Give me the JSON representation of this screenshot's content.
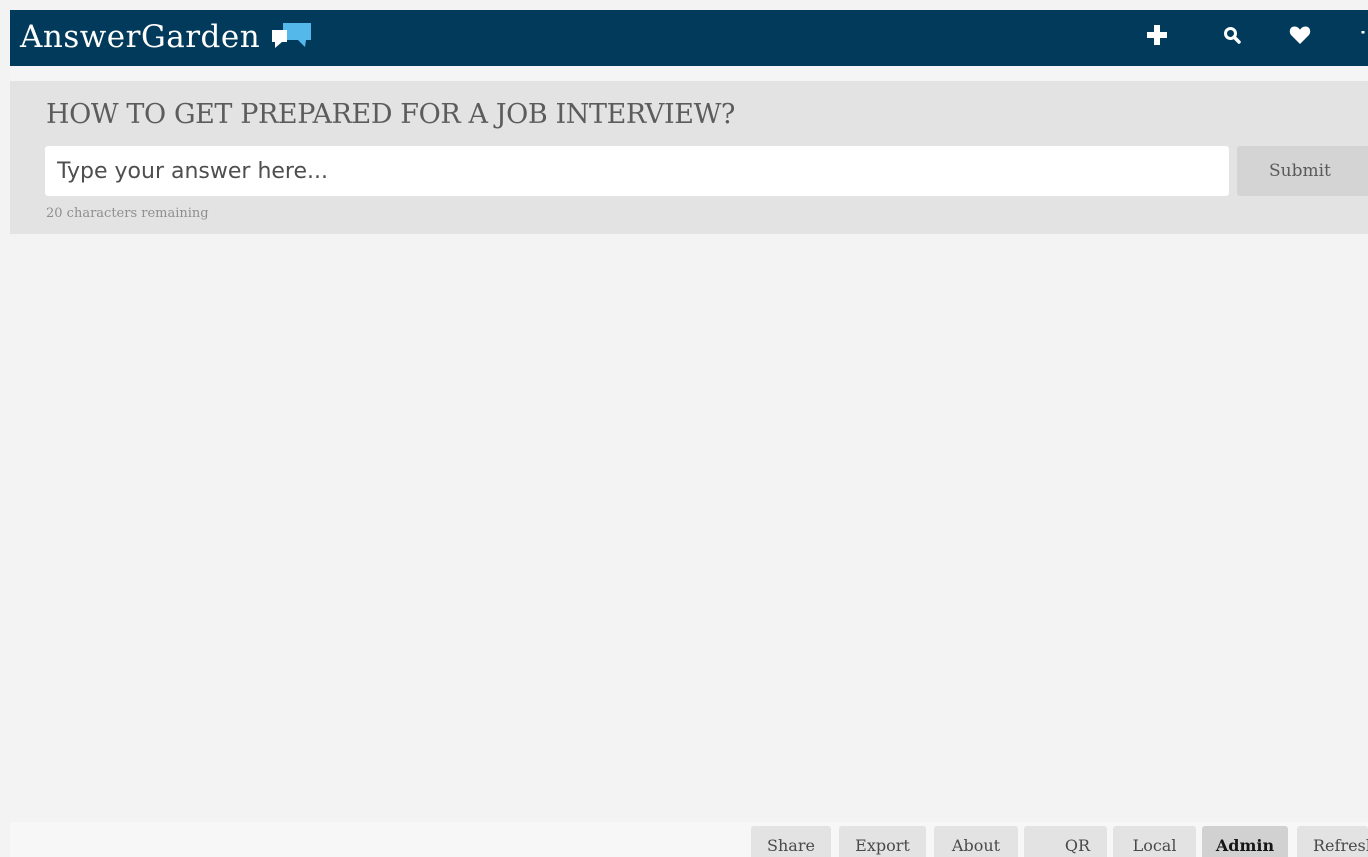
{
  "brand": {
    "name": "AnswerGarden",
    "logo_icon": "speech-bubbles-icon"
  },
  "nav": {
    "icons": [
      "plus-icon",
      "search-icon",
      "heart-icon",
      "menu-icon"
    ]
  },
  "question": {
    "title": "HOW TO GET PREPARED FOR A JOB INTERVIEW?",
    "answer_placeholder": "Type your answer here...",
    "answer_value": "",
    "submit_label": "Submit",
    "chars_remaining": "20 characters remaining"
  },
  "footer": {
    "tabs": [
      {
        "label": "Share",
        "active": false
      },
      {
        "label": "Export",
        "active": false
      },
      {
        "label": "About",
        "active": false
      },
      {
        "label": "QR",
        "active": false
      },
      {
        "label": "Local",
        "active": false
      },
      {
        "label": "Admin",
        "active": true
      },
      {
        "label": "Refresh",
        "active": false
      }
    ]
  },
  "colors": {
    "topbar": "#013a5a",
    "panel": "#e3e3e3",
    "background": "#f3f3f3",
    "logo_light_blue": "#54b9ea",
    "logo_white": "#ffffff"
  }
}
